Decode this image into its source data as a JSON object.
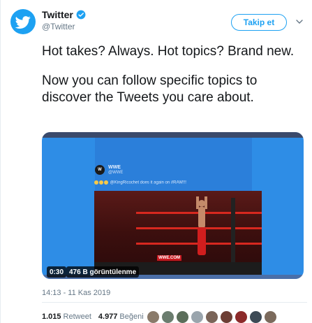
{
  "author": {
    "display_name": "Twitter",
    "handle": "@Twitter",
    "verified": true,
    "avatar_icon": "twitter-bird-icon",
    "brand_color": "#1da1f2"
  },
  "follow_button": {
    "label": "Takip et"
  },
  "menu": {
    "icon": "chevron-down-icon"
  },
  "tweet": {
    "paragraphs": [
      "Hot takes? Always. Hot topics? Brand new.",
      "Now you can follow specific topics to discover the Tweets you care about."
    ]
  },
  "media": {
    "embedded_account": {
      "name": "WWE",
      "handle": "@WWE"
    },
    "embedded_text": "@KingRicochet does it again on #RAW!!!",
    "broadcast_bug": "WWE.COM",
    "duration": "0:30",
    "views": "476 B görüntülenme"
  },
  "timestamp": "14:13 - 11 Kas 2019",
  "stats": {
    "retweets_count": "1.015",
    "retweets_label": "Retweet",
    "likes_count": "4.977",
    "likes_label": "Beğeni"
  },
  "likers": {
    "colors": [
      "#8a7a6a",
      "#6b7d6f",
      "#5b6e5a",
      "#9aa5ad",
      "#7a6458",
      "#6d3e35",
      "#8c2a2a",
      "#3d4a55",
      "#7b6a5c"
    ]
  }
}
